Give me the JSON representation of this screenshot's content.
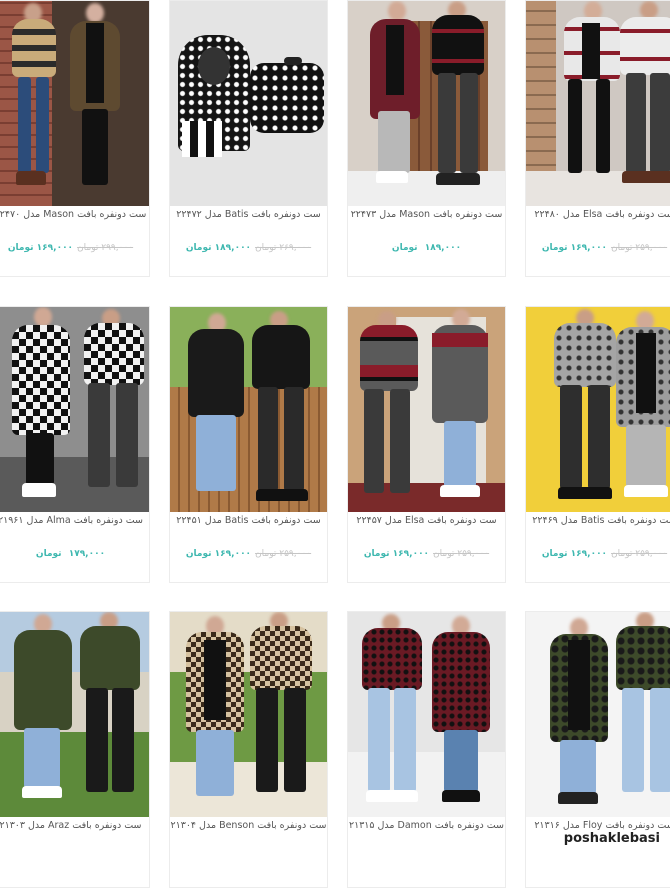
{
  "products": [
    {
      "title": "ست دونفره بافت Mason مدل ۲۲۴۷۰",
      "old_price": "۲۹۹,۰۰۰ تومان",
      "new_price": "۱۶۹,۰۰۰ تومان"
    },
    {
      "title": "ست دونفره بافت Batis مدل ۲۲۴۷۲",
      "old_price": "۲۶۹,۰۰۰ تومان",
      "new_price": "۱۸۹,۰۰۰ تومان"
    },
    {
      "title": "ست دونفره بافت Mason مدل ۲۲۴۷۳",
      "old_price": "",
      "new_price": "۱۸۹,۰۰۰ تومان"
    },
    {
      "title": "ست دونفره بافت Elsa مدل ۲۲۴۸۰",
      "old_price": "۲۵۹,۰۰۰ تومان",
      "new_price": "۱۶۹,۰۰۰ تومان"
    },
    {
      "title": "ست دونفره بافت Alma مدل ۲۱۹۶۱",
      "old_price": "",
      "new_price": "۱۷۹,۰۰۰ تومان"
    },
    {
      "title": "ست دونفره بافت Batis مدل ۲۲۴۵۱",
      "old_price": "۲۵۹,۰۰۰ تومان",
      "new_price": "۱۶۹,۰۰۰ تومان"
    },
    {
      "title": "ست دونفره بافت Elsa مدل ۲۲۴۵۷",
      "old_price": "۲۵۹,۰۰۰ تومان",
      "new_price": "۱۶۹,۰۰۰ تومان"
    },
    {
      "title": "ست دونفره بافت Batis مدل ۲۲۴۶۹",
      "old_price": "۲۵۹,۰۰۰ تومان",
      "new_price": "۱۶۹,۰۰۰ تومان"
    },
    {
      "title": "ست دونفره بافت Araz مدل ۲۱۳۰۳",
      "old_price": "",
      "new_price": ""
    },
    {
      "title": "ست دونفره بافت Benson مدل ۲۱۳۰۴",
      "old_price": "",
      "new_price": ""
    },
    {
      "title": "ست دونفره بافت Damon مدل ۲۱۳۱۵",
      "old_price": "",
      "new_price": ""
    },
    {
      "title": "ست دونفره بافت Floy مدل ۲۱۳۱۶",
      "old_price": "",
      "new_price": ""
    }
  ],
  "watermark": "poshaklebasi",
  "colors": {
    "accent": "#3fb8b0",
    "old_price": "#c5c5c5",
    "title": "#555555"
  }
}
